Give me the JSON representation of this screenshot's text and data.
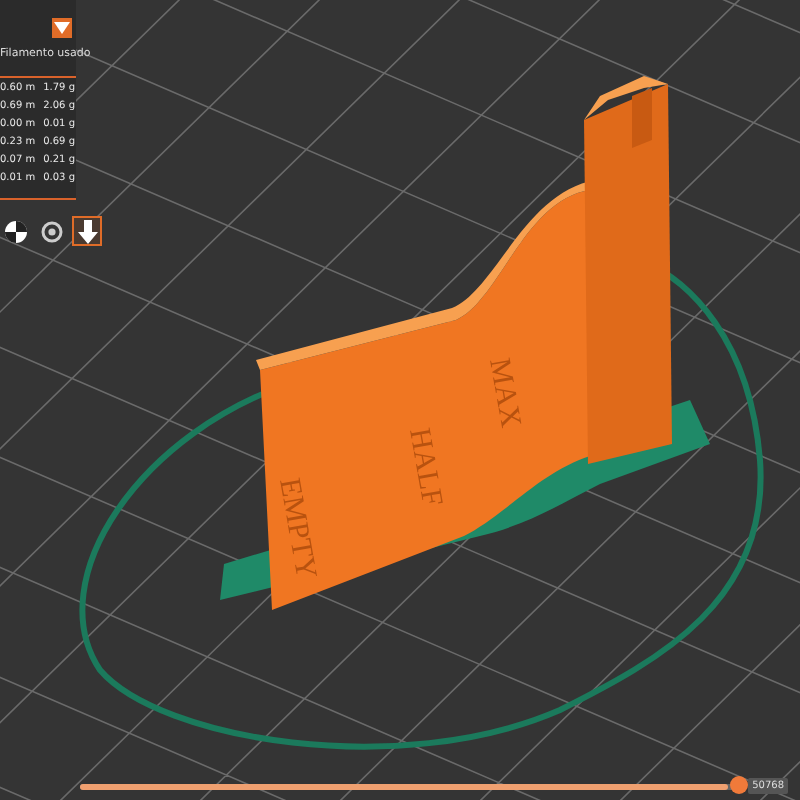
{
  "legend": {
    "header": "Filamento usado",
    "rows": [
      {
        "length": "0.60 m",
        "weight": "1.79 g"
      },
      {
        "length": "0.69 m",
        "weight": "2.06 g"
      },
      {
        "length": "0.00 m",
        "weight": "0.01 g"
      },
      {
        "length": "0.23 m",
        "weight": "0.69 g"
      },
      {
        "length": "0.07 m",
        "weight": "0.21 g"
      },
      {
        "length": "0.01 m",
        "weight": "0.03 g"
      }
    ]
  },
  "view_tools": [
    {
      "kind": "shading",
      "selected": false
    },
    {
      "kind": "extents",
      "selected": false
    },
    {
      "kind": "export",
      "selected": true
    }
  ],
  "model_labels": [
    "EMPTY",
    "HALF",
    "MAX"
  ],
  "layer_slider": {
    "level": 1.0,
    "value": "50768"
  }
}
